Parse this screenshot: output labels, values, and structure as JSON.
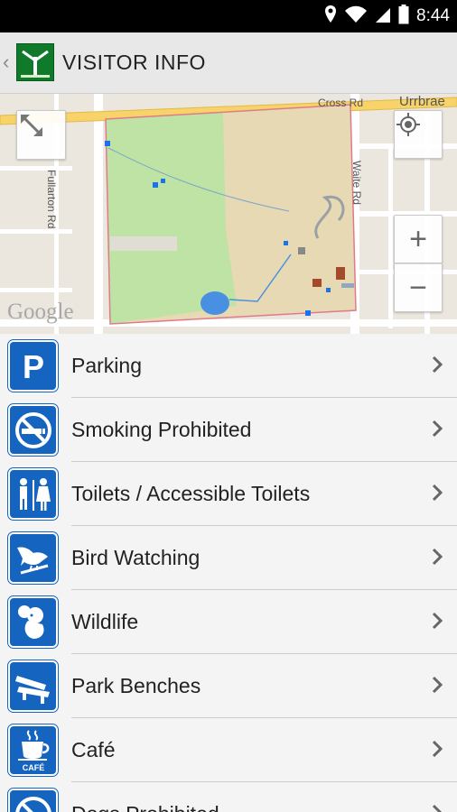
{
  "status_bar": {
    "time": "8:44",
    "icons": [
      "location-icon",
      "wifi-icon",
      "signal-icon",
      "battery-icon"
    ]
  },
  "action_bar": {
    "title": "VISITOR INFO"
  },
  "map": {
    "attribution": "Google",
    "roads": {
      "cross": "Cross Rd",
      "urrbrae": "Urrbrae",
      "fullarton": "Fullarton Rd",
      "waite": "Waite Rd"
    },
    "controls": {
      "zoom_in": "+",
      "zoom_out": "−"
    },
    "colors": {
      "park_green": "#bfe3a4",
      "sand": "#e8d9b5",
      "boundary": "#e07a8a",
      "water": "#4a90e2"
    }
  },
  "list": {
    "items": [
      {
        "label": "Parking",
        "icon": "parking-icon"
      },
      {
        "label": "Smoking Prohibited",
        "icon": "no-smoking-icon"
      },
      {
        "label": "Toilets / Accessible Toilets",
        "icon": "toilets-icon"
      },
      {
        "label": "Bird Watching",
        "icon": "bird-icon"
      },
      {
        "label": "Wildlife",
        "icon": "koala-icon"
      },
      {
        "label": "Park Benches",
        "icon": "bench-icon"
      },
      {
        "label": "Café",
        "icon": "cafe-icon",
        "icon_caption": "CAFÉ"
      },
      {
        "label": "Dogs Prohibited",
        "icon": "no-dogs-icon"
      }
    ],
    "accent": "#1565c0"
  }
}
